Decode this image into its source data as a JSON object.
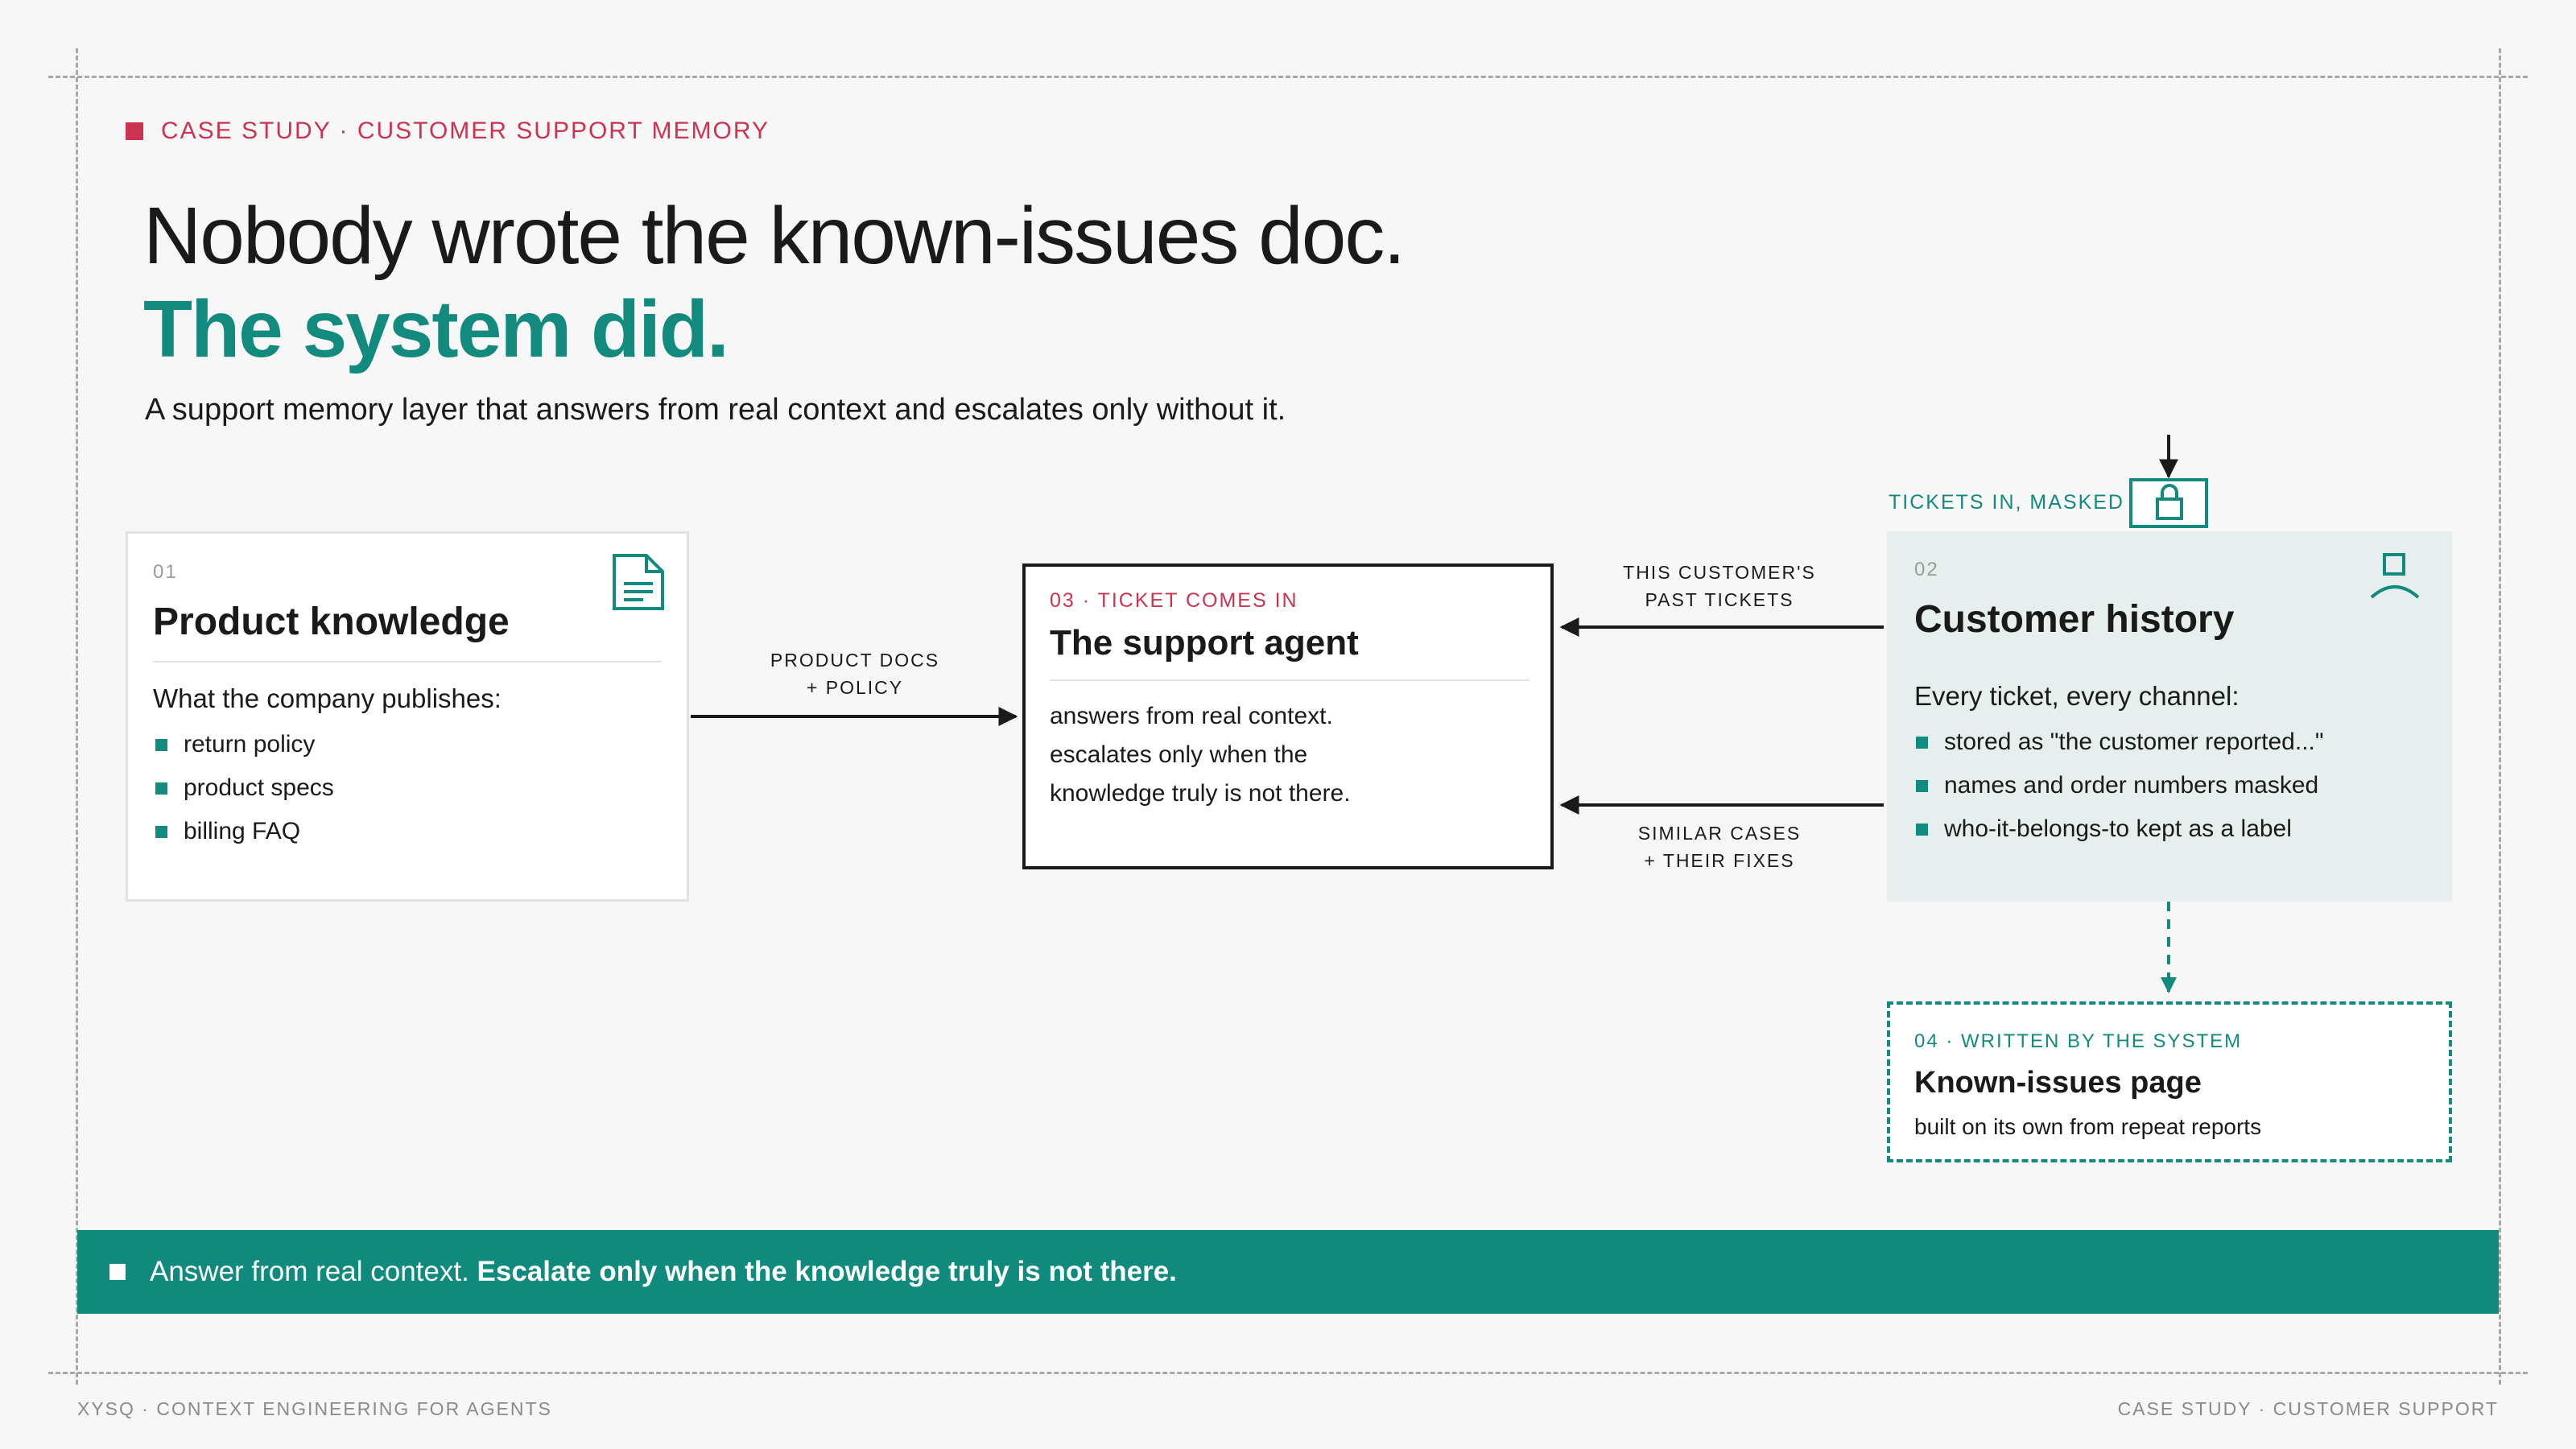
{
  "eyebrow": "CASE STUDY · CUSTOMER SUPPORT MEMORY",
  "title_line1": "Nobody wrote the known-issues doc.",
  "title_line2": "The system did.",
  "subtitle": "A support memory layer that answers from real context and escalates only without it.",
  "product_card": {
    "number": "01",
    "title": "Product knowledge",
    "intro": "What the company publishes:",
    "items": [
      "return policy",
      "product specs",
      "billing FAQ"
    ],
    "icon": "document-icon"
  },
  "agent_card": {
    "tag": "03 · TICKET COMES IN",
    "title": "The support agent",
    "lines": [
      "answers from real context.",
      "escalates only when the",
      "knowledge truly is not there."
    ]
  },
  "history_card": {
    "number": "02",
    "title": "Customer history",
    "intro": "Every ticket, every channel:",
    "items": [
      "stored as \"the customer reported...\"",
      "names and order numbers masked",
      "who-it-belongs-to kept as a label"
    ],
    "icon": "person-icon"
  },
  "known_issues_card": {
    "tag": "04 · WRITTEN BY THE SYSTEM",
    "title": "Known-issues page",
    "subtitle": "built on its own from repeat reports"
  },
  "arrows": {
    "product_to_agent": [
      "PRODUCT DOCS",
      "+ POLICY"
    ],
    "past_tickets": [
      "THIS CUSTOMER'S",
      "PAST TICKETS"
    ],
    "similar_cases": [
      "SIMILAR CASES",
      "+ THEIR FIXES"
    ],
    "tickets_in": "TICKETS IN, MASKED"
  },
  "banner": {
    "regular": "Answer from real context.",
    "bold": "Escalate only when the knowledge truly is not there."
  },
  "footer": {
    "left": "XYSQ · CONTEXT ENGINEERING FOR AGENTS",
    "right": "CASE STUDY · CUSTOMER SUPPORT"
  },
  "colors": {
    "accent_teal": "#128a7d",
    "accent_red": "#cc3350",
    "history_bg": "#e6efed",
    "banner_bg": "#0f8a7c"
  }
}
